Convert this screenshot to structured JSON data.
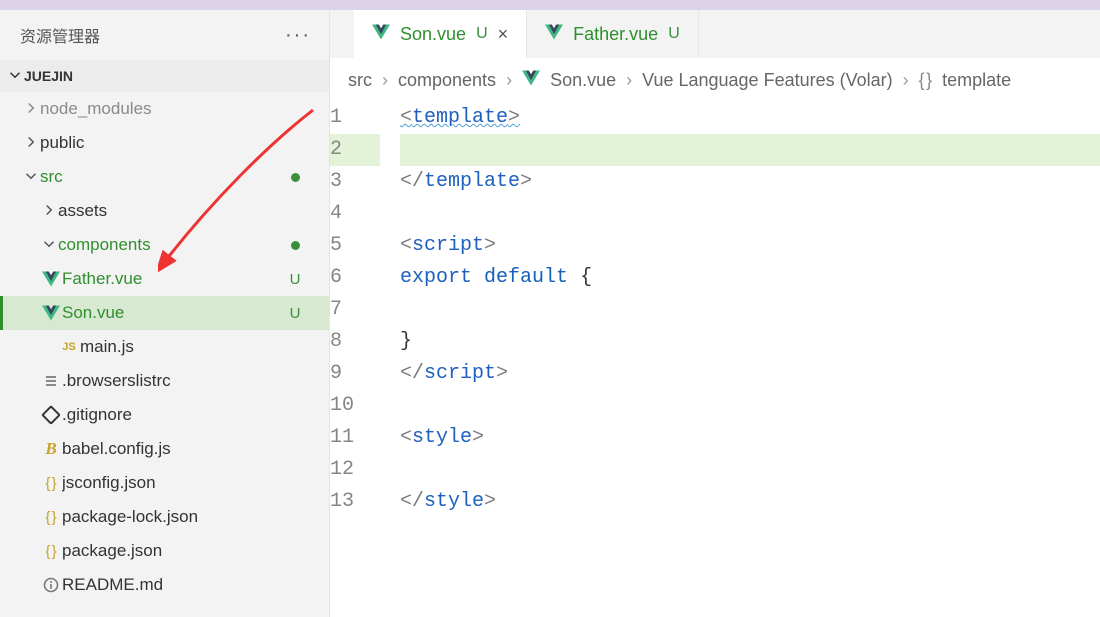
{
  "sidebar": {
    "title": "资源管理器",
    "section": "JUEJIN",
    "items": {
      "node_modules": "node_modules",
      "public": "public",
      "src": "src",
      "assets": "assets",
      "components": "components",
      "father": "Father.vue",
      "son": "Son.vue",
      "mainjs": "main.js",
      "browserslist": ".browserslistrc",
      "gitignore": ".gitignore",
      "babel": "babel.config.js",
      "jsconfig": "jsconfig.json",
      "pkglock": "package-lock.json",
      "pkg": "package.json",
      "readme": "README.md"
    },
    "status_u": "U"
  },
  "tabs": {
    "son": "Son.vue",
    "father": "Father.vue",
    "u": "U"
  },
  "crumbs": {
    "c1": "src",
    "c2": "components",
    "c3": "Son.vue",
    "c4": "Vue Language Features (Volar)",
    "c5": "template"
  },
  "lines": {
    "l1": "1",
    "l2": "2",
    "l3": "3",
    "l4": "4",
    "l5": "5",
    "l6": "6",
    "l7": "7",
    "l8": "8",
    "l9": "9",
    "l10": "10",
    "l11": "11",
    "l12": "12",
    "l13": "13"
  },
  "code": {
    "tag_template": "template",
    "tag_script": "script",
    "tag_style": "style",
    "kw_export": "export",
    "kw_default": "default"
  }
}
